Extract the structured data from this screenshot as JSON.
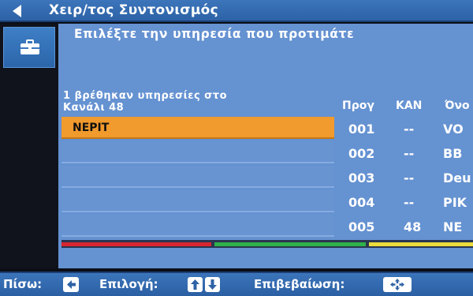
{
  "header": {
    "title": "Χειρ/τος Συντονισμός"
  },
  "prompt": "Επιλέξτε την υπηρεσία που προτιμάτε",
  "found": {
    "line1": "1 βρέθηκαν υπηρεσίες στο",
    "line2": "Κανάλι 48"
  },
  "columns": {
    "prog": "Προγ",
    "kan": "ΚΑΝ",
    "name": "Όνο"
  },
  "services": [
    {
      "label": "ΝΕΡΙΤ",
      "selected": true
    },
    {
      "label": "",
      "selected": false
    },
    {
      "label": "",
      "selected": false
    },
    {
      "label": "",
      "selected": false
    },
    {
      "label": "",
      "selected": false
    }
  ],
  "channels": [
    {
      "prog": "001",
      "kan": "--",
      "name": "VO"
    },
    {
      "prog": "002",
      "kan": "--",
      "name": "BB"
    },
    {
      "prog": "003",
      "kan": "--",
      "name": "Deu"
    },
    {
      "prog": "004",
      "kan": "--",
      "name": "PIK"
    },
    {
      "prog": "005",
      "kan": "48",
      "name": "NE"
    }
  ],
  "help": {
    "back": "Πίσω:",
    "select": "Επιλογή:",
    "confirm": "Επιβεβαίωση:"
  },
  "icons": {
    "back": "left-triangle-icon",
    "menu": "toolbox-icon",
    "key_left": "left-arrow-key-icon",
    "key_up": "up-arrow-key-icon",
    "key_down": "down-arrow-key-icon",
    "key_ok": "ok-cross-key-icon"
  },
  "colors": {
    "bar": "#3c75bb",
    "panel": "#6592d1",
    "selected": "#f19a2d",
    "red": "#d8262e",
    "green": "#2fb24a",
    "yellow": "#e9dc3c"
  }
}
